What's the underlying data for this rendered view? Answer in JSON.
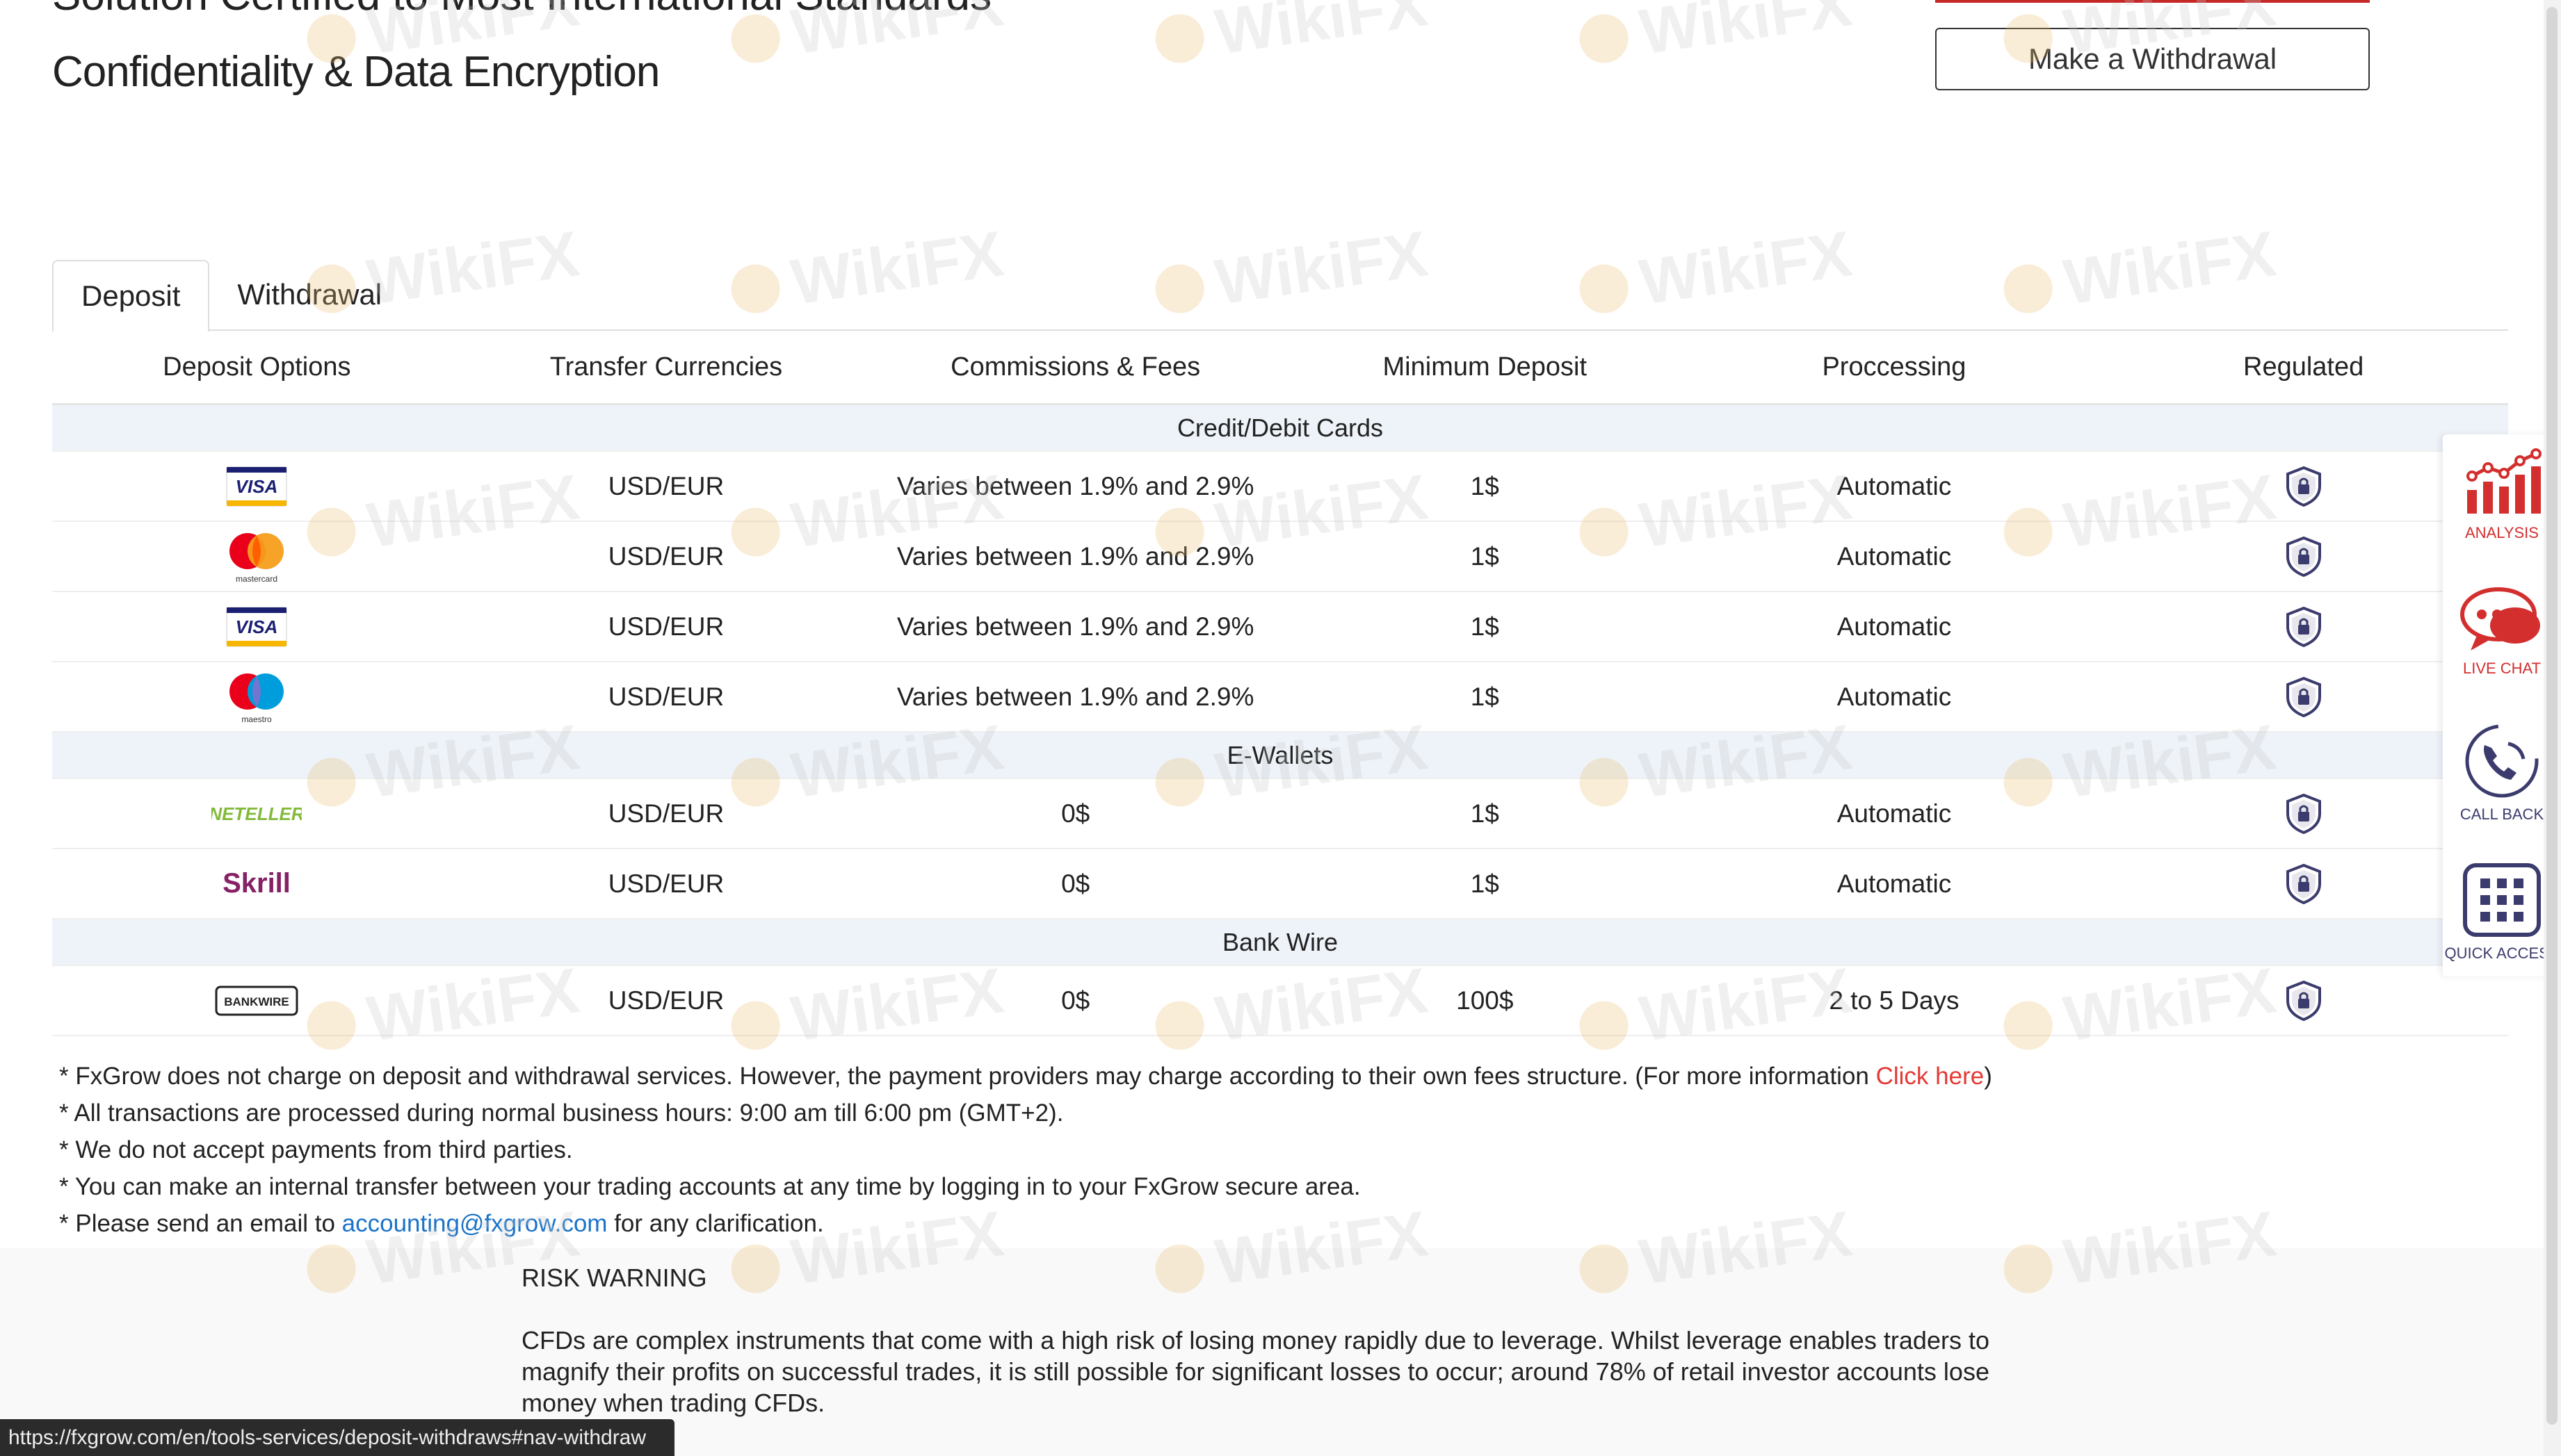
{
  "header": {
    "title_partial": "Solution Certified to Most International Standards",
    "title": "Confidentiality & Data Encryption",
    "withdraw_button": "Make a Withdrawal"
  },
  "tabs": [
    {
      "label": "Deposit",
      "active": true
    },
    {
      "label": "Withdrawal",
      "active": false
    }
  ],
  "table": {
    "columns": [
      "Deposit Options",
      "Transfer Currencies",
      "Commissions & Fees",
      "Minimum Deposit",
      "Proccessing",
      "Regulated"
    ],
    "groups": [
      {
        "name": "Credit/Debit Cards",
        "rows": [
          {
            "method": "Visa",
            "icon": "visa-icon",
            "currency": "USD/EUR",
            "fees": "Varies between 1.9% and 2.9%",
            "min": "1$",
            "processing": "Automatic"
          },
          {
            "method": "Mastercard",
            "icon": "mastercard-icon",
            "currency": "USD/EUR",
            "fees": "Varies between 1.9% and 2.9%",
            "min": "1$",
            "processing": "Automatic"
          },
          {
            "method": "Visa",
            "icon": "visa-icon",
            "currency": "USD/EUR",
            "fees": "Varies between 1.9% and 2.9%",
            "min": "1$",
            "processing": "Automatic"
          },
          {
            "method": "Maestro",
            "icon": "maestro-icon",
            "currency": "USD/EUR",
            "fees": "Varies between 1.9% and 2.9%",
            "min": "1$",
            "processing": "Automatic"
          }
        ]
      },
      {
        "name": "E-Wallets",
        "rows": [
          {
            "method": "Neteller",
            "icon": "neteller-icon",
            "currency": "USD/EUR",
            "fees": "0$",
            "min": "1$",
            "processing": "Automatic"
          },
          {
            "method": "Skrill",
            "icon": "skrill-icon",
            "currency": "USD/EUR",
            "fees": "0$",
            "min": "1$",
            "processing": "Automatic"
          }
        ]
      },
      {
        "name": "Bank Wire",
        "rows": [
          {
            "method": "Bank Wire",
            "icon": "bankwire-icon",
            "currency": "USD/EUR",
            "fees": "0$",
            "min": "100$",
            "processing": "2 to 5 Days"
          }
        ]
      }
    ]
  },
  "icon_text": {
    "visa": "VISA",
    "mastercard": "mastercard",
    "maestro": "maestro",
    "neteller": "NETELLER",
    "skrill": "Skrill",
    "bankwire": "BANKWIRE"
  },
  "notes": {
    "line1_text": "* FxGrow does not charge on deposit and withdrawal services. However, the payment providers may charge according to their own fees structure. (For more information ",
    "line1_link": "Click here",
    "line1_end": ")",
    "line2": "* All transactions are processed during normal business hours: 9:00 am till 6:00 pm (GMT+2).",
    "line3": "* We do not accept payments from third parties.",
    "line4": "* You can make an internal transfer between your trading accounts at any time by logging in to your FxGrow secure area.",
    "line5_text": "* Please send an email to ",
    "line5_link": "accounting@fxgrow.com",
    "line5_end": "   for any clarification."
  },
  "risk": {
    "title": "RISK WARNING",
    "text": "CFDs are complex instruments that come with a high risk of losing money rapidly due to leverage. Whilst leverage enables traders to magnify their profits on successful trades, it is still possible for significant losses to occur; around 78% of retail investor accounts lose money when trading CFDs."
  },
  "status_bar": {
    "url": "https://fxgrow.com/en/tools-services/deposit-withdraws#nav-withdraw"
  },
  "side_panel": [
    {
      "label": "ANALYSIS",
      "icon": "analysis-chart-icon"
    },
    {
      "label": "LIVE CHAT",
      "icon": "chat-bubble-icon"
    },
    {
      "label": "CALL BACK",
      "icon": "phone-icon"
    },
    {
      "label": "QUICK ACCESS",
      "icon": "grid-icon"
    }
  ],
  "watermark": "WikiFX",
  "colors": {
    "link_red": "#e53935",
    "link_blue": "#1a73c8",
    "accent_red": "#d32f2f",
    "shield": "#3b3b6d",
    "group_bg": "#eef3f9",
    "visa_blue": "#1a1f71",
    "visa_gold": "#f7b600",
    "neteller_green": "#83ba3b",
    "skrill_purple": "#862165"
  }
}
